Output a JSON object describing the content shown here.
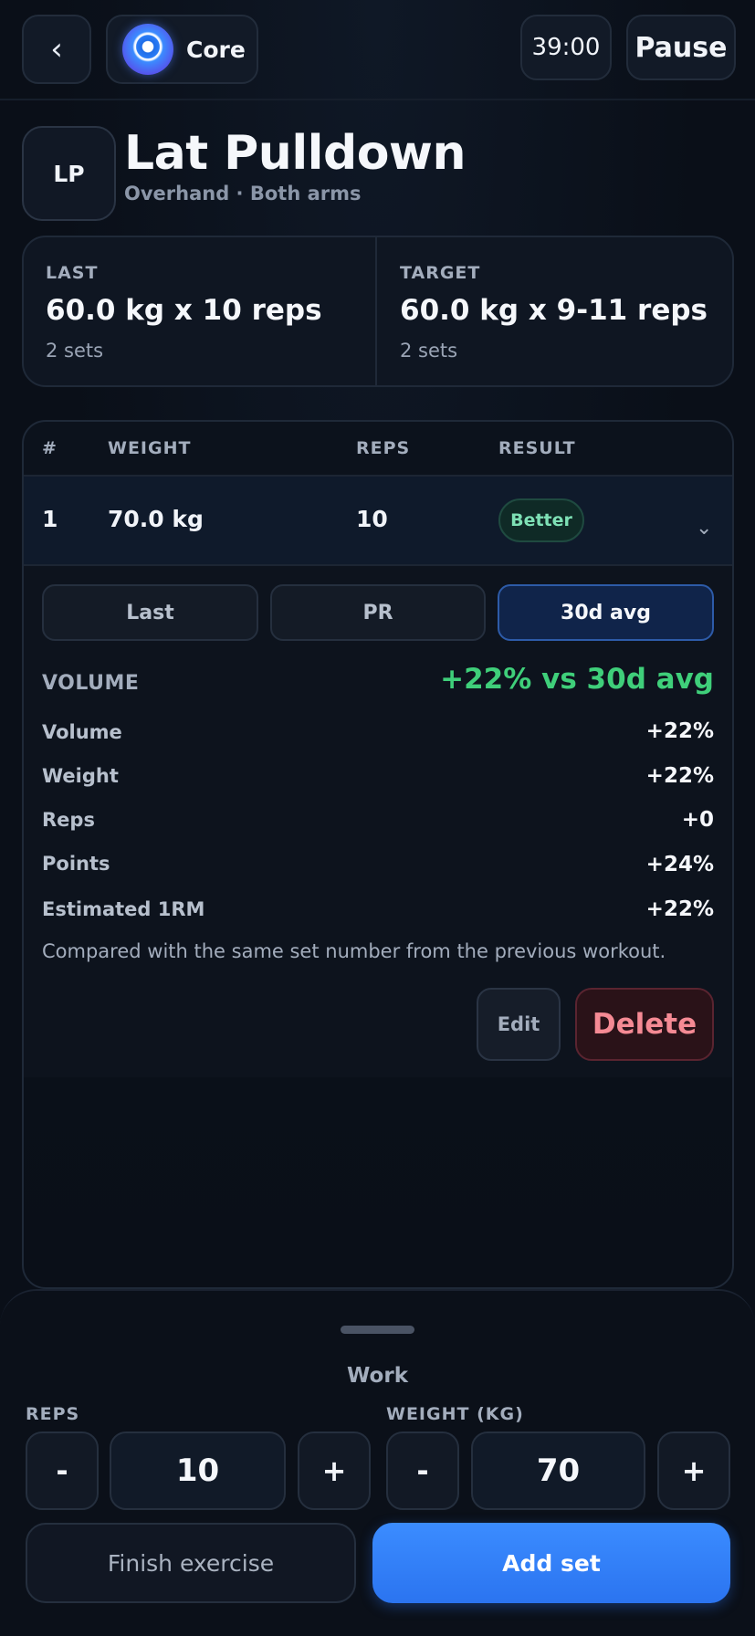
{
  "header": {
    "back_icon": "chevron-left-icon",
    "back_glyph": "‹",
    "program_label": "Core",
    "timer": "39:00",
    "pause_label": "Pause"
  },
  "exercise": {
    "badge": "LP",
    "title": "Lat Pulldown",
    "subtitle": "Overhand · Both arms"
  },
  "last": {
    "label": "LAST",
    "value": "60.0 kg x 10 reps",
    "sets": "2 sets"
  },
  "target": {
    "label": "TARGET",
    "value": "60.0 kg x 9-11 reps",
    "sets": "2 sets"
  },
  "table": {
    "headers": [
      "#",
      "WEIGHT",
      "REPS",
      "RESULT"
    ],
    "rows": [
      {
        "num": "1",
        "weight": "70.0 kg",
        "reps": "10",
        "result": "Better",
        "expand_glyph": "⌄"
      }
    ]
  },
  "compare": {
    "tabs": [
      "Last",
      "PR",
      "30d avg"
    ],
    "active_tab": "30d avg",
    "heading": "VOLUME",
    "summary": "+22% vs 30d avg",
    "metrics": [
      {
        "label": "Volume",
        "value": "+22%"
      },
      {
        "label": "Weight",
        "value": "+22%"
      },
      {
        "label": "Reps",
        "value": "+0"
      },
      {
        "label": "Points",
        "value": "+24%"
      },
      {
        "label": "Estimated 1RM",
        "value": "+22%"
      }
    ],
    "note": "Compared with the same set number from the previous workout.",
    "edit_label": "Edit",
    "delete_label": "Delete"
  },
  "entry": {
    "section_label": "Work",
    "reps_label": "REPS",
    "weight_label": "WEIGHT (KG)",
    "reps_value": "10",
    "weight_value": "70",
    "minus": "-",
    "plus": "+",
    "finish_label": "Finish exercise",
    "add_label": "Add set"
  },
  "colors": {
    "accent": "#2b74f0",
    "positive": "#3fcf7a",
    "danger": "#f58a94",
    "background": "#0a0f18"
  }
}
